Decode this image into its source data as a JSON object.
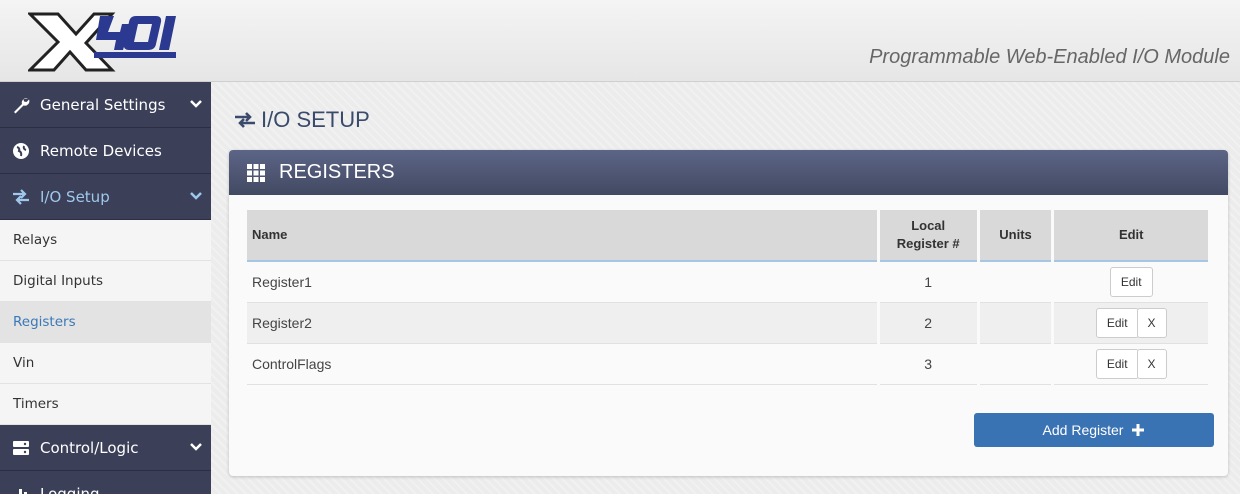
{
  "header": {
    "logo_text": "X40I",
    "tagline": "Programmable Web-Enabled I/O Module"
  },
  "sidebar": {
    "items": [
      {
        "label": "General Settings",
        "icon": "wrench-icon"
      },
      {
        "label": "Remote Devices",
        "icon": "globe-icon"
      },
      {
        "label": "I/O Setup",
        "icon": "exchange-icon"
      },
      {
        "label": "Control/Logic",
        "icon": "server-icon"
      },
      {
        "label": "Logging",
        "icon": "chart-icon"
      }
    ],
    "subitems": [
      "Relays",
      "Digital Inputs",
      "Registers",
      "Vin",
      "Timers"
    ],
    "active_subitem": "Registers"
  },
  "page": {
    "title": "I/O SETUP"
  },
  "panel": {
    "title": "REGISTERS"
  },
  "table": {
    "columns": [
      "Name",
      "Local Register #",
      "Units",
      "Edit"
    ],
    "rows": [
      {
        "name": "Register1",
        "local": "1",
        "units": "",
        "edit": "Edit",
        "delete": ""
      },
      {
        "name": "Register2",
        "local": "2",
        "units": "",
        "edit": "Edit",
        "delete": "X"
      },
      {
        "name": "ControlFlags",
        "local": "3",
        "units": "",
        "edit": "Edit",
        "delete": "X"
      }
    ]
  },
  "actions": {
    "add_label": "Add Register"
  },
  "colors": {
    "sidebar_bg": "#3b3f58",
    "active_link": "#3b78b7",
    "panel_header": "#4f5675",
    "primary_button": "#3a73b3"
  }
}
